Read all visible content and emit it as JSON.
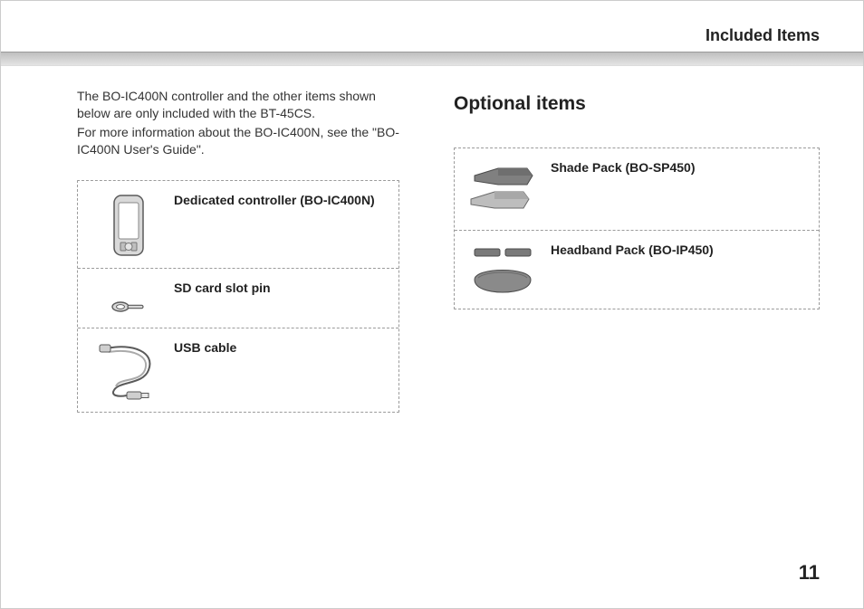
{
  "header": {
    "title": "Included Items"
  },
  "left": {
    "paragraph1": "The BO-IC400N controller and the other items shown below are only included with the BT-45CS.",
    "paragraph2": "For more information about the BO-IC400N, see the \"BO-IC400N User's Guide\".",
    "items": [
      {
        "label": "Dedicated controller (BO-IC400N)"
      },
      {
        "label": "SD card slot pin"
      },
      {
        "label": "USB cable"
      }
    ]
  },
  "right": {
    "heading": "Optional items",
    "items": [
      {
        "label": "Shade Pack (BO-SP450)"
      },
      {
        "label": "Headband Pack (BO-IP450)"
      }
    ]
  },
  "page_number": "11"
}
